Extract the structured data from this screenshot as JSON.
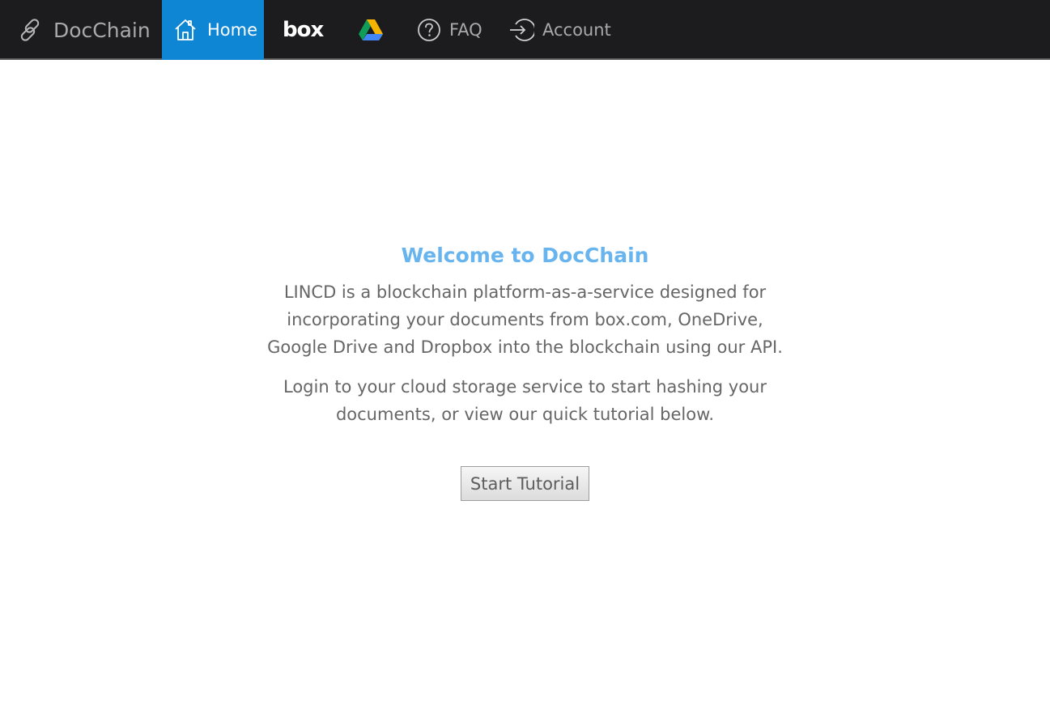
{
  "nav": {
    "brand_label": "DocChain",
    "home_label": "Home",
    "box_label": "box",
    "faq_label": "FAQ",
    "account_label": "Account",
    "brand_icon": "link-icon",
    "home_icon": "home-icon",
    "drive_icon": "google-drive-icon",
    "faq_icon": "question-circle-icon",
    "account_icon": "sign-in-icon",
    "active_color": "#0e86d4",
    "bar_color": "#1c1c1e"
  },
  "main": {
    "title": "Welcome to DocChain",
    "paragraph1": "LINCD is a blockchain platform-as-a-service designed for incorporating your documents from box.com, OneDrive, Google Drive and Dropbox into the blockchain using our API.",
    "paragraph2": "Login to your cloud storage service to start hashing your documents, or view our quick tutorial below.",
    "start_button": "Start Tutorial",
    "title_color": "#67b4ee"
  }
}
